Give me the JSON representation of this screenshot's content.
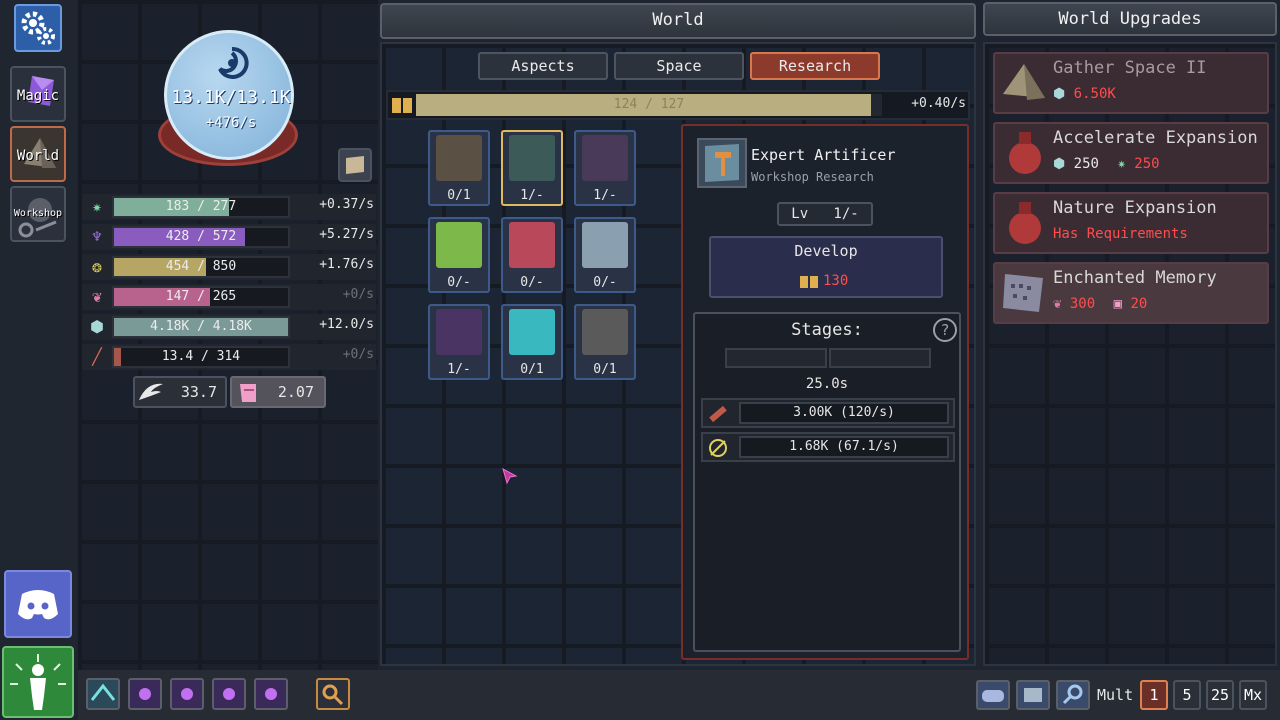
{
  "nav": {
    "magic": "Magic",
    "world": "World",
    "workshop": "Workshop"
  },
  "mana": {
    "value": "13.1K/13.1K",
    "rate": "+476/s"
  },
  "resources": [
    {
      "icon": "star-shard-icon",
      "value": "183 / 277",
      "rate": "+0.37/s",
      "color": "#7fae9a",
      "fill": 0.66
    },
    {
      "icon": "spirit-icon",
      "value": "428 / 572",
      "rate": "+5.27/s",
      "color": "#8a5cc0",
      "fill": 0.75
    },
    {
      "icon": "leaf-icon",
      "value": "454 / 850",
      "rate": "+1.76/s",
      "color": "#b5a664",
      "fill": 0.53
    },
    {
      "icon": "heart-cluster-icon",
      "value": "147 / 265",
      "rate": "+0/s",
      "color": "#b8638e",
      "fill": 0.55
    },
    {
      "icon": "cube-icon",
      "value": "4.18K / 4.18K",
      "rate": "+12.0/s",
      "color": "#7a9a98",
      "fill": 1.0
    },
    {
      "icon": "wood-log-icon",
      "value": "13.4 / 314",
      "rate": "+0/s",
      "color": "#a6564a",
      "fill": 0.04
    }
  ],
  "extras": {
    "wings": "33.7",
    "scroll": "2.07"
  },
  "world": {
    "title": "World",
    "tabs": [
      "Aspects",
      "Space",
      "Research"
    ],
    "progress_text": "124 / 127",
    "progress_fill": 0.976,
    "progress_rate": "+0.40/s",
    "items": [
      {
        "lvl": "0/1",
        "color": "#5a5044"
      },
      {
        "lvl": "1/-",
        "color": "#3c5a58"
      },
      {
        "lvl": "1/-",
        "color": "#4a3a5a"
      },
      {
        "lvl": "0/-",
        "color": "#7cb84a"
      },
      {
        "lvl": "0/-",
        "color": "#b8485a"
      },
      {
        "lvl": "0/-",
        "color": "#8aa0b0"
      },
      {
        "lvl": "1/-",
        "color": "#4a3464"
      },
      {
        "lvl": "0/1",
        "color": "#3ab8c0"
      },
      {
        "lvl": "0/1",
        "color": "#5a5a5a"
      }
    ]
  },
  "detail": {
    "name": "Expert Artificer",
    "subtitle": "Workshop Research",
    "level": "Lv   1/-",
    "develop_label": "Develop",
    "develop_cost": "130",
    "stages_label": "Stages:",
    "time": "25.0s",
    "req1": "3.00K (120/s)",
    "req2": "1.68K (67.1/s)"
  },
  "upgrades": {
    "title": "World Upgrades",
    "items": [
      {
        "name": "Gather Space II",
        "cost1": "6.50K"
      },
      {
        "name": "Accelerate Expansion",
        "cost1": "250",
        "cost2": "250"
      },
      {
        "name": "Nature Expansion",
        "req": "Has Requirements"
      },
      {
        "name": "Enchanted Memory",
        "cost1": "300",
        "cost2": "20"
      }
    ]
  },
  "bottom": {
    "mult_label": "Mult",
    "mults": [
      "1",
      "5",
      "25",
      "Mx"
    ]
  }
}
